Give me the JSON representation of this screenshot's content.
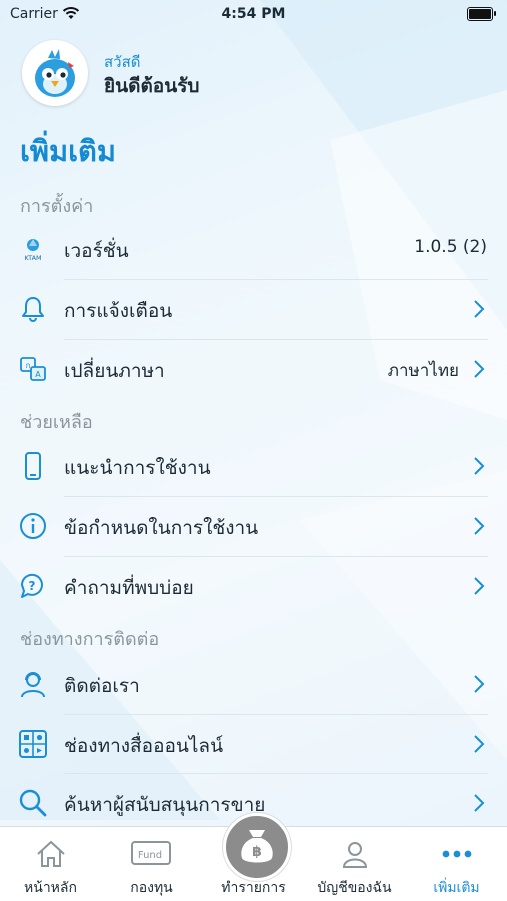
{
  "status_bar": {
    "carrier": "Carrier",
    "time": "4:54 PM"
  },
  "profile": {
    "greeting": "สวัสดี",
    "welcome": "ยินดีต้อนรับ"
  },
  "page_title": "เพิ่มเติม",
  "sections": {
    "settings": "การตั้งค่า",
    "help": "ช่วยเหลือ",
    "contact": "ช่องทางการติดต่อ"
  },
  "rows": {
    "version": {
      "label": "เวอร์ชั่น",
      "value": "1.0.5 (2)",
      "logo_text": "KTAM"
    },
    "notifications": {
      "label": "การแจ้งเตือน"
    },
    "language": {
      "label": "เปลี่ยนภาษา",
      "value": "ภาษาไทย"
    },
    "guide": {
      "label": "แนะนำการใช้งาน"
    },
    "terms": {
      "label": "ข้อกำหนดในการใช้งาน"
    },
    "faq": {
      "label": "คำถามที่พบบ่อย"
    },
    "contact_us": {
      "label": "ติดต่อเรา"
    },
    "online_channels": {
      "label": "ช่องทางสื่อออนไลน์"
    },
    "find_agent": {
      "label": "ค้นหาผู้สนับสนุนการขาย"
    }
  },
  "tabbar": {
    "home": "หน้าหลัก",
    "fund": "กองทุน",
    "fund_icon_text": "Fund",
    "transact": "ทำรายการ",
    "account": "บัญชีของฉัน",
    "more": "เพิ่มเติม"
  },
  "colors": {
    "accent": "#1a8fd6",
    "text": "#1d2b36",
    "muted": "#8a959c"
  }
}
